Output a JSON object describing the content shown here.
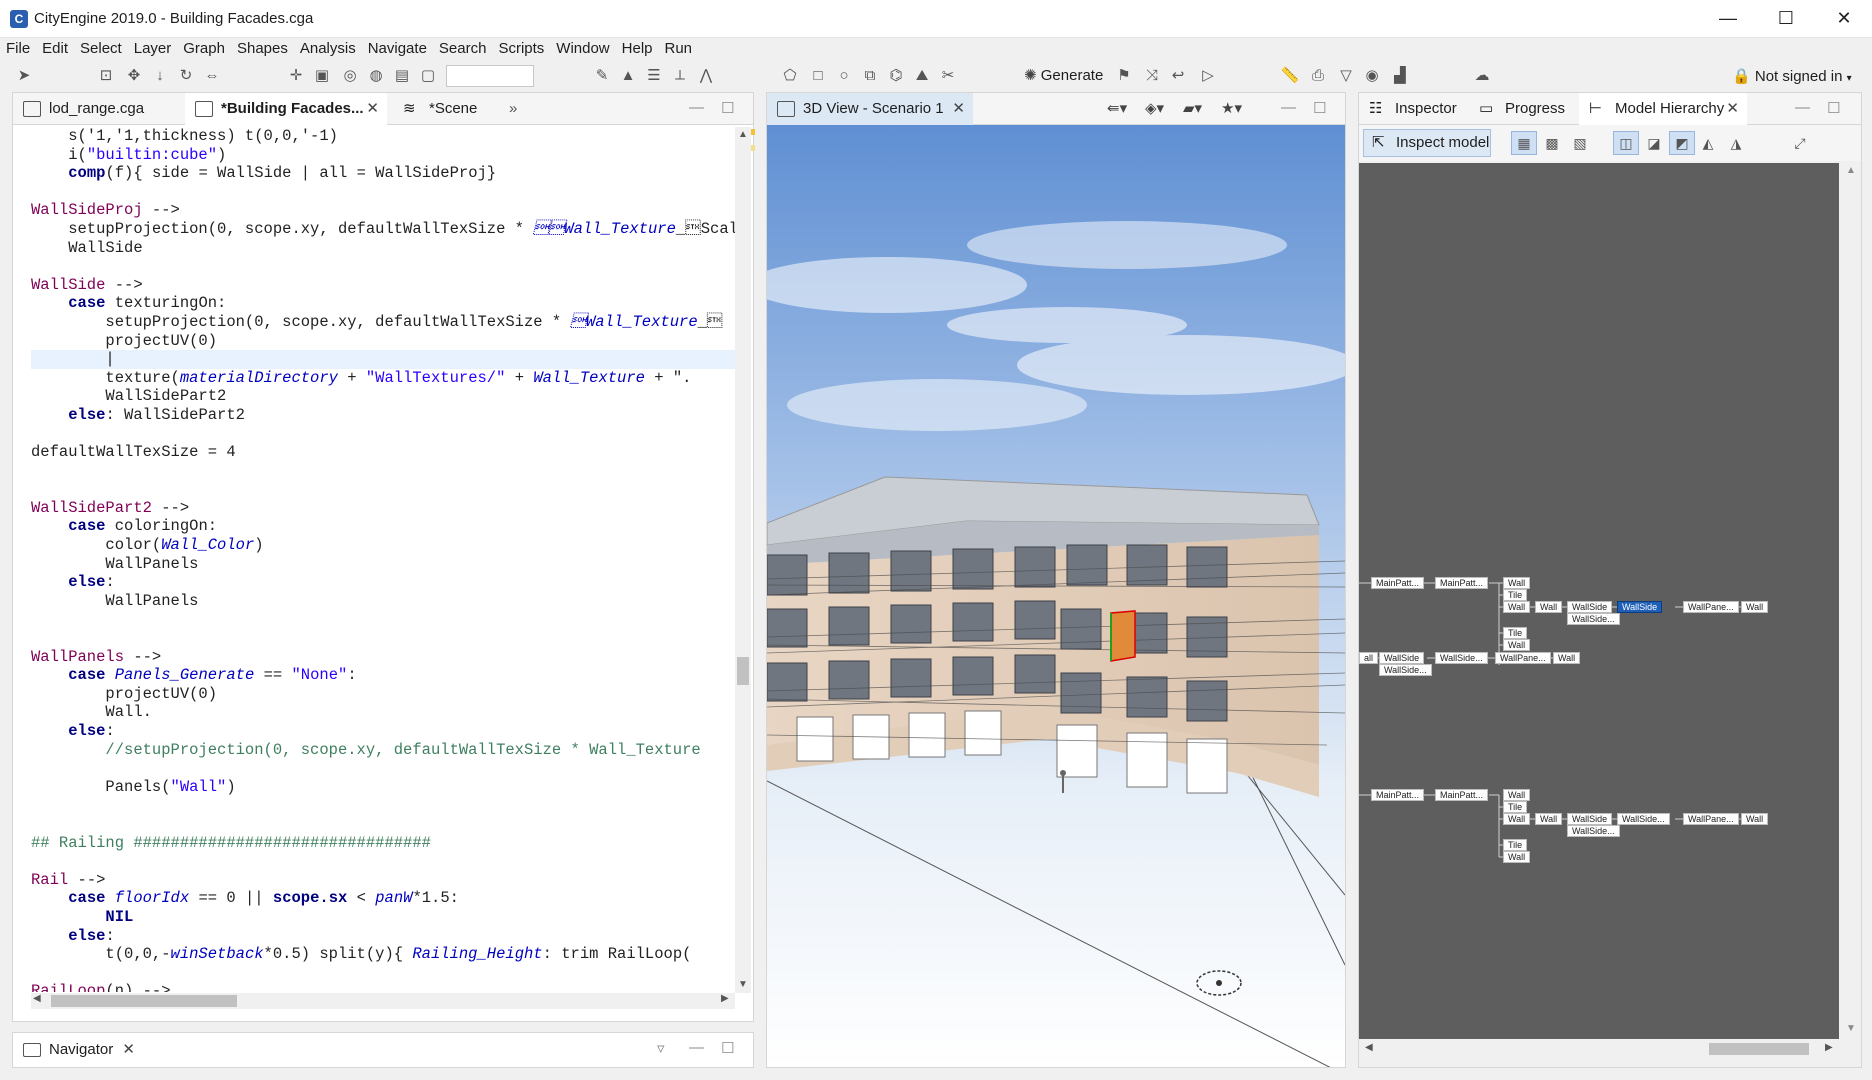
{
  "window": {
    "title": "CityEngine 2019.0 - Building Facades.cga",
    "minimize_glyph": "—",
    "maximize_glyph": "☐",
    "close_glyph": "✕"
  },
  "menu": [
    "File",
    "Edit",
    "Select",
    "Layer",
    "Graph",
    "Shapes",
    "Analysis",
    "Navigate",
    "Search",
    "Scripts",
    "Window",
    "Help",
    "Run"
  ],
  "toolbar": {
    "generate_label": "Generate",
    "sign_in_label": "Not signed in"
  },
  "editor": {
    "tabs": [
      {
        "label": "lod_range.cga"
      },
      {
        "label": "*Building Facades..."
      },
      {
        "label": "*Scene"
      }
    ],
    "overflow_label": "»",
    "code_lines": [
      "    s('1,'1,thickness) t(0,0,'-1)",
      "    i(\"builtin:cube\")",
      "    comp(f){ side = WallSide | all = WallSideProj}",
      "",
      "WallSideProj -->",
      "    setupProjection(0, scope.xy, defaultWallTexSize * Wall_Texture_Scal",
      "    WallSide",
      "",
      "WallSide -->",
      "    case texturingOn:",
      "        setupProjection(0, scope.xy, defaultWallTexSize * Wall_Texture_",
      "        projectUV(0)",
      "        |",
      "        texture(materialDirectory + \"WallTextures/\" + Wall_Texture + \".",
      "        WallSidePart2",
      "    else: WallSidePart2",
      "",
      "defaultWallTexSize = 4",
      "",
      "",
      "WallSidePart2 -->",
      "    case coloringOn:",
      "        color(Wall_Color)",
      "        WallPanels",
      "    else:",
      "        WallPanels",
      "",
      "",
      "WallPanels -->",
      "    case Panels_Generate == \"None\":",
      "        projectUV(0)",
      "        Wall.",
      "    else:",
      "        //setupProjection(0, scope.xy, defaultWallTexSize * Wall_Texture",
      "",
      "        Panels(\"Wall\")",
      "",
      "",
      "## Railing ################################",
      "",
      "Rail -->",
      "    case floorIdx == 0 || scope.sx < panW*1.5:",
      "        NIL",
      "    else:",
      "        t(0,0,-winSetback*0.5) split(y){ Railing_Height: trim RailLoop(",
      "",
      "RailLoop(n) -->"
    ]
  },
  "view3d": {
    "tab_label": "3D View - Scenario 1"
  },
  "right": {
    "tabs": [
      {
        "label": "Inspector"
      },
      {
        "label": "Progress"
      },
      {
        "label": "Model Hierarchy"
      }
    ],
    "inspect_label": "Inspect model",
    "hierarchy_nodes": {
      "g1": [
        "MainPatt...",
        "MainPatt...",
        "Wall",
        "Tile",
        "Wall",
        "Wall",
        "WallSide",
        "WallSide",
        "WallPane...",
        "Wall",
        "WallSide...",
        "Tile",
        "Wall"
      ],
      "g2": [
        "all",
        "WallSide",
        "WallSide...",
        "WallPane...",
        "Wall",
        "WallSide..."
      ],
      "g3": [
        "MainPatt...",
        "MainPatt...",
        "Wall",
        "Tile",
        "Wall",
        "Wall",
        "WallSide",
        "WallSide...",
        "WallPane...",
        "Wall",
        "WallSide...",
        "Tile",
        "Wall"
      ]
    }
  },
  "navigator": {
    "tab_label": "Navigator"
  },
  "colors": {
    "selection": "#1f5fb8",
    "hierarchy_bg": "#5e5e5e",
    "keyword": "#000080",
    "rule": "#7f0055"
  }
}
